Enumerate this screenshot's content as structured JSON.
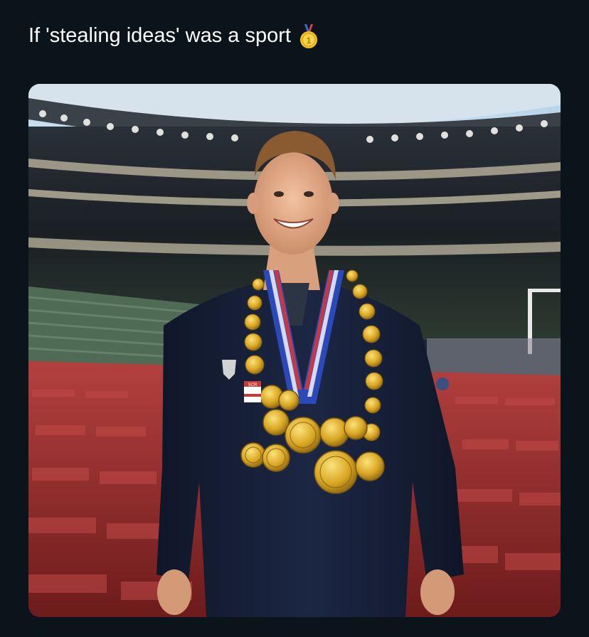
{
  "post": {
    "text": "If 'stealing ideas' was a sport",
    "emoji": "1st-place-medal-icon"
  },
  "media": {
    "type": "photo",
    "medal_label": "SCR"
  },
  "colors": {
    "background": "#0c141b",
    "text": "#ffffff",
    "medal_gold": "#e8b420",
    "ribbon_blue": "#2b49b8",
    "seat_red": "#9a2a2c",
    "jacket_navy": "#141d33"
  }
}
